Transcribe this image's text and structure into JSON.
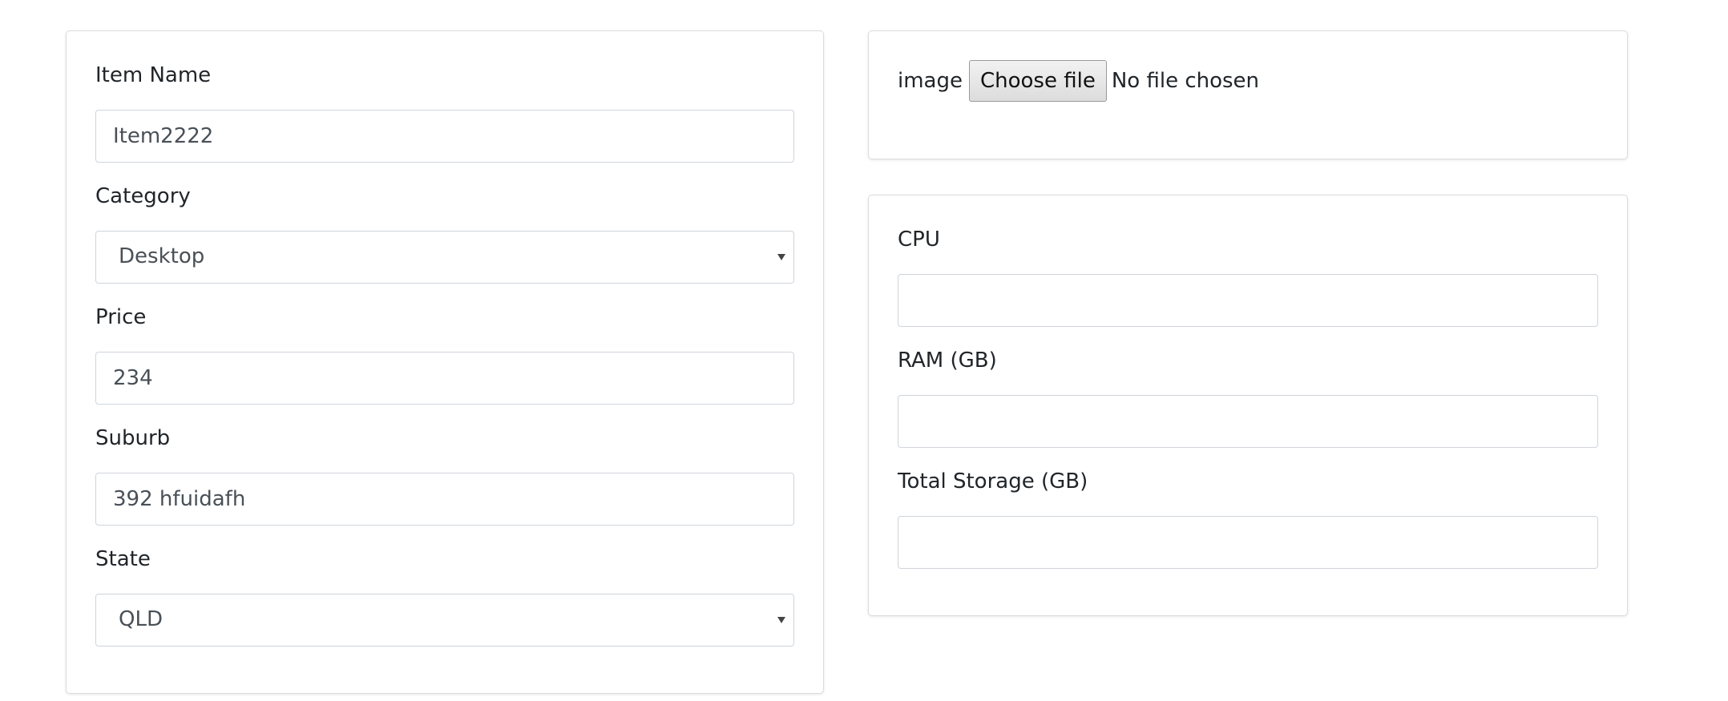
{
  "item_form": {
    "item_name": {
      "label": "Item Name",
      "value": "Item2222"
    },
    "category": {
      "label": "Category",
      "selected": "Desktop"
    },
    "price": {
      "label": "Price",
      "value": "234"
    },
    "suburb": {
      "label": "Suburb",
      "value": "392 hfuidafh"
    },
    "state": {
      "label": "State",
      "selected": "QLD"
    }
  },
  "image_upload": {
    "label": "image",
    "button_label": "Choose file",
    "status": "No file chosen"
  },
  "specs": {
    "cpu": {
      "label": "CPU",
      "value": ""
    },
    "ram": {
      "label": "RAM (GB)",
      "value": ""
    },
    "storage": {
      "label": "Total Storage (GB)",
      "value": ""
    }
  },
  "icons": {
    "select_caret": "caret-down-icon"
  }
}
